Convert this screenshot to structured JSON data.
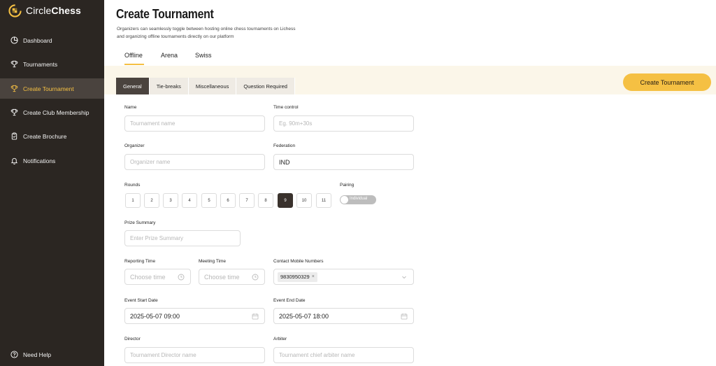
{
  "brand": {
    "prefix": "Circle",
    "suffix": "Chess"
  },
  "sidebar": {
    "items": [
      {
        "label": "Dashboard",
        "icon": "dashboard-icon"
      },
      {
        "label": "Tournaments",
        "icon": "trophy-icon"
      },
      {
        "label": "Create Tournament",
        "icon": "trophy-icon",
        "active": true
      },
      {
        "label": "Create Club Membership",
        "icon": "trophy-icon"
      },
      {
        "label": "Create Brochure",
        "icon": "clipboard-icon"
      },
      {
        "label": "Notifications",
        "icon": "bell-icon"
      }
    ],
    "help": "Need Help"
  },
  "header": {
    "title": "Create Tournament",
    "subtitle": "Organizers can seamlessly toggle between hosting online chess tournaments on Lichess and organizing offline tournaments directly on our platform"
  },
  "mode_tabs": [
    "Offline",
    "Arena",
    "Swiss"
  ],
  "sub_tabs": [
    "General",
    "Tie-breaks",
    "Miscellaneous",
    "Question Required"
  ],
  "create_button": "Create Tournament",
  "form": {
    "name": {
      "label": "Name",
      "placeholder": "Tournament name"
    },
    "time_control": {
      "label": "Time control",
      "placeholder": "Eg. 90m+30s"
    },
    "organizer": {
      "label": "Organizer",
      "placeholder": "Organizer name"
    },
    "federation": {
      "label": "Federation",
      "value": "IND"
    },
    "rounds": {
      "label": "Rounds",
      "options": [
        "1",
        "2",
        "3",
        "4",
        "5",
        "6",
        "7",
        "8",
        "9",
        "10",
        "11"
      ],
      "selected": "9"
    },
    "pairing": {
      "label": "Pairing",
      "value": "Individual"
    },
    "prize_summary": {
      "label": "Prize Summary",
      "placeholder": "Enter Prize Summary"
    },
    "reporting_time": {
      "label": "Reporting Time",
      "placeholder": "Choose time"
    },
    "meeting_time": {
      "label": "Meeting Time",
      "placeholder": "Choose time"
    },
    "contact": {
      "label": "Contact Mobile Numbers",
      "tags": [
        "9830950329"
      ]
    },
    "event_start": {
      "label": "Event Start Date",
      "value": "2025-05-07 09:00"
    },
    "event_end": {
      "label": "Event End Date",
      "value": "2025-05-07 18:00"
    },
    "director": {
      "label": "Director",
      "placeholder": "Tournament Director name"
    },
    "arbiter": {
      "label": "Arbiter",
      "placeholder": "Tournament chief arbiter name"
    }
  },
  "colors": {
    "sidebar": "#2b2622",
    "accent": "#f5c043",
    "active_tab": "#4a433e",
    "band": "#fbf6e9"
  }
}
